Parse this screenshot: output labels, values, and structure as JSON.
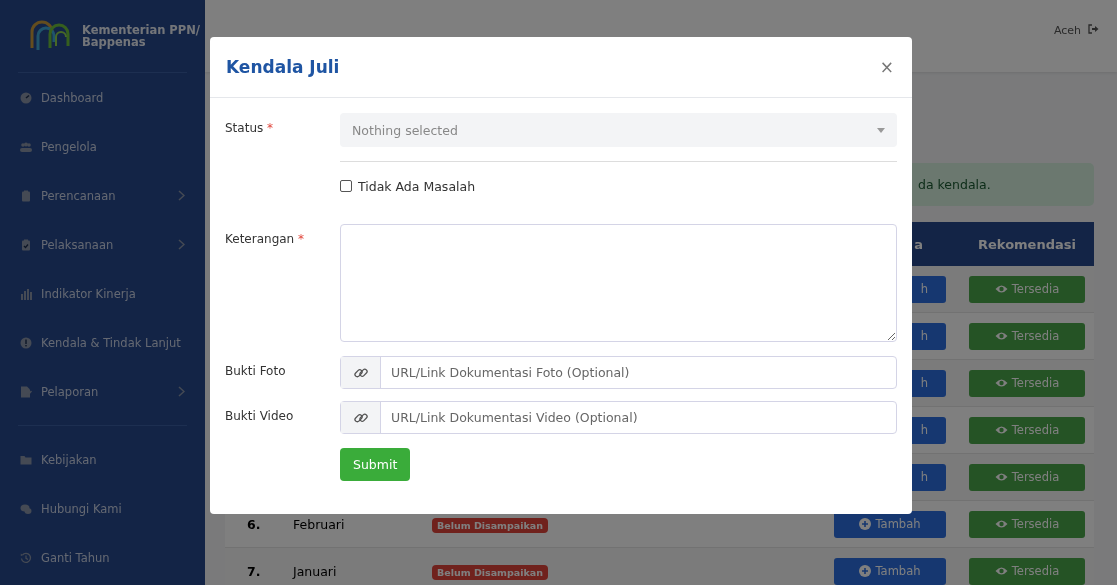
{
  "brand": {
    "line1": "Kementerian PPN/",
    "line2": "Bappenas"
  },
  "sidebar": {
    "sections": [
      {
        "items": [
          {
            "kind": "dashboard",
            "label": "Dashboard",
            "expandable": false
          },
          {
            "kind": "people",
            "label": "Pengelola",
            "expandable": false
          },
          {
            "kind": "clipboard",
            "label": "Perencanaan",
            "expandable": true
          },
          {
            "kind": "clipboard-check",
            "label": "Pelaksanaan",
            "expandable": true
          },
          {
            "kind": "chart",
            "label": "Indikator Kinerja",
            "expandable": false
          },
          {
            "kind": "alert",
            "label": "Kendala & Tindak Lanjut",
            "expandable": false
          },
          {
            "kind": "report",
            "label": "Pelaporan",
            "expandable": true
          }
        ]
      },
      {
        "items": [
          {
            "kind": "folder",
            "label": "Kebijakan",
            "expandable": false
          },
          {
            "kind": "chat",
            "label": "Hubungi Kami",
            "expandable": false
          },
          {
            "kind": "history",
            "label": "Ganti Tahun",
            "expandable": false
          }
        ]
      }
    ]
  },
  "topbar": {
    "user": "Aceh"
  },
  "alert": "da kendala.",
  "table": {
    "columns": [
      {
        "label": "a"
      },
      {
        "label": "Rekomendasi"
      }
    ],
    "rows": [
      {
        "no": null,
        "month": null,
        "status": null,
        "action": "h",
        "recommendation": "Tersedia"
      },
      {
        "no": null,
        "month": null,
        "status": null,
        "action": "h",
        "recommendation": "Tersedia"
      },
      {
        "no": null,
        "month": null,
        "status": null,
        "action": "h",
        "recommendation": "Tersedia"
      },
      {
        "no": null,
        "month": null,
        "status": null,
        "action": "h",
        "recommendation": "Tersedia"
      },
      {
        "no": null,
        "month": null,
        "status": null,
        "action": "h",
        "recommendation": "Tersedia"
      },
      {
        "no": "6.",
        "month": "Februari",
        "status": "Belum Disampaikan",
        "action": "Tambah",
        "recommendation": "Tersedia"
      },
      {
        "no": "7.",
        "month": "Januari",
        "status": "Belum Disampaikan",
        "action": "Tambah",
        "recommendation": "Tersedia"
      }
    ]
  },
  "modal": {
    "title": "Kendala Juli",
    "close": "×",
    "fields": [
      {
        "kind": "select",
        "label": "Status",
        "required_mark": "*",
        "placeholder": "Nothing selected"
      },
      {
        "kind": "checkbox",
        "label": "Tidak Ada Masalah",
        "checked": false
      },
      {
        "kind": "textarea",
        "label": "Keterangan",
        "required_mark": "*"
      },
      {
        "kind": "link",
        "label": "Bukti Foto",
        "placeholder": "URL/Link Dokumentasi Foto (Optional)"
      },
      {
        "kind": "link",
        "label": "Bukti Video",
        "placeholder": "URL/Link Dokumentasi Video (Optional)"
      }
    ],
    "submit": "Submit"
  }
}
